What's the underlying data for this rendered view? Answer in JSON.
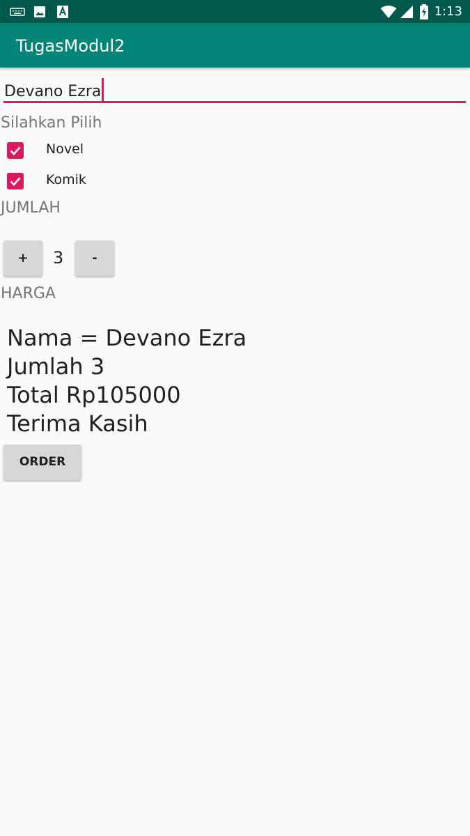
{
  "status_bar": {
    "time": "1:13",
    "icons": [
      "keyboard-icon",
      "image-icon",
      "text-a-icon",
      "wifi-icon",
      "signal-icon",
      "battery-icon"
    ]
  },
  "app_bar": {
    "title": "TugasModul2",
    "color": "#008577"
  },
  "form": {
    "name_value": "Devano Ezra",
    "choice_label": "Silahkan Pilih",
    "options": [
      {
        "label": "Novel",
        "checked": true
      },
      {
        "label": "Komik",
        "checked": true
      }
    ],
    "quantity_label": "JUMLAH",
    "increment_label": "+",
    "quantity_value": "3",
    "decrement_label": "-",
    "price_label": "HARGA"
  },
  "summary": {
    "line1": "Nama = Devano Ezra",
    "line2": "Jumlah 3",
    "line3": "Total Rp105000",
    "line4": "Terima Kasih"
  },
  "actions": {
    "order_label": "ORDER"
  },
  "colors": {
    "accent": "#d81b60",
    "status_bar": "#00574b",
    "background": "#fafafa"
  }
}
